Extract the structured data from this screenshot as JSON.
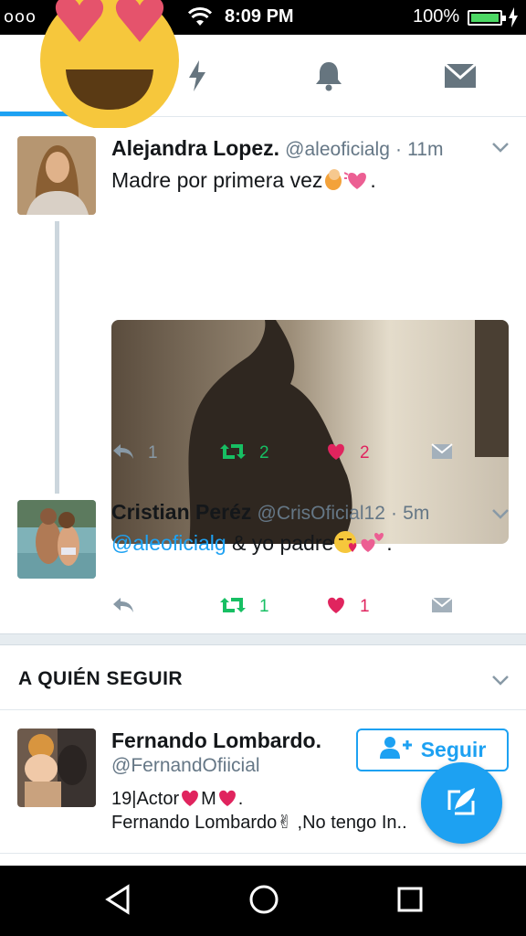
{
  "status_bar": {
    "carrier": "ooo",
    "time": "8:09 PM",
    "battery": "100%"
  },
  "tabs": [
    {
      "icon": "home-icon",
      "active": true
    },
    {
      "icon": "moments-lightning-icon",
      "active": false
    },
    {
      "icon": "notifications-bell-icon",
      "active": false
    },
    {
      "icon": "messages-envelope-icon",
      "active": false
    }
  ],
  "tweets": [
    {
      "name": "Alejandra Lopez.",
      "handle": "@aleoficialg",
      "separator": "·",
      "time": "11m",
      "text": "Madre por primera vez",
      "text_suffix": ".",
      "has_media": true,
      "replies": "1",
      "retweets": "2",
      "likes": "2"
    },
    {
      "name": "Cristian Peréz",
      "handle": "@CrisOficial12",
      "separator": "·",
      "time": "5m",
      "mention": "@aleoficialg",
      "text": " & yo padre",
      "text_suffix": ".",
      "replies": "",
      "retweets": "1",
      "likes": "1"
    }
  ],
  "who_to_follow": {
    "title": "A QUIÉN SEGUIR",
    "user": {
      "name": "Fernando Lombardo.",
      "handle": "@FernandOfiicial",
      "bio_line1_a": "19|Actor",
      "bio_line1_b": "M",
      "bio_line1_c": ".",
      "bio_line2": "Fernando Lombardo✌ ,No tengo In",
      "bio_line2_end": "..",
      "follow_label": "Seguir"
    }
  },
  "colors": {
    "accent": "#1da1f2",
    "retweet": "#17bf63",
    "like": "#e0245e",
    "muted": "#657786"
  }
}
